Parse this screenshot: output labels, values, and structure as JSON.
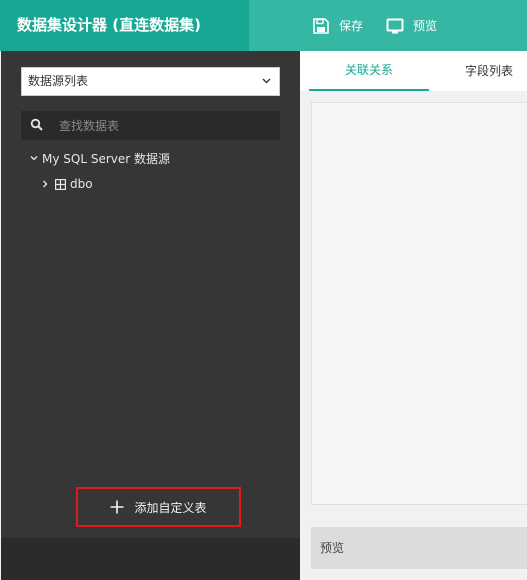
{
  "header": {
    "title": "数据集设计器 (直连数据集)",
    "save_label": "保存",
    "preview_label": "预览"
  },
  "sidebar": {
    "datasource_select": {
      "selected": "数据源列表"
    },
    "search": {
      "placeholder": "查找数据表",
      "value": ""
    },
    "tree": {
      "root_label": "My SQL Server 数据源",
      "children": [
        {
          "label": "dbo"
        }
      ]
    },
    "add_button_label": "添加自定义表"
  },
  "main": {
    "tabs": [
      {
        "label": "关联关系",
        "active": true
      },
      {
        "label": "字段列表",
        "active": false
      }
    ],
    "preview_label": "预览"
  },
  "colors": {
    "accent": "#17a894",
    "header_bg": "#36b7a3",
    "sidebar_bg": "#363636",
    "highlight_border": "#e01b1b"
  },
  "icons": [
    "save-icon",
    "monitor-icon",
    "search-icon",
    "chevron-down-icon",
    "chevron-right-icon",
    "table-icon",
    "plus-icon"
  ]
}
